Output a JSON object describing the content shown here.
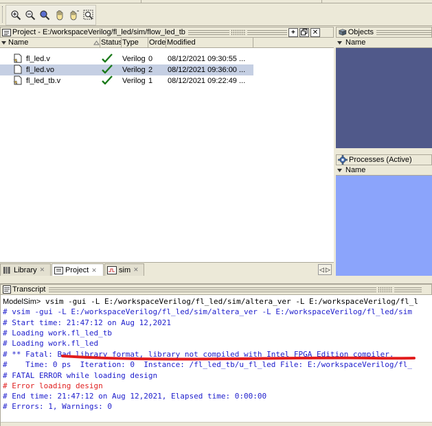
{
  "project_panel": {
    "title": "Project - E:/workspaceVerilog/fl_led/sim/flow_led_tb",
    "columns": [
      "Name",
      "Status",
      "Type",
      "Order",
      "Modified"
    ],
    "files": [
      {
        "name": "fl_led.v",
        "type": "Verilog",
        "order": "0",
        "modified": "08/12/2021 09:30:55 ..."
      },
      {
        "name": "fl_led.vo",
        "type": "Verilog",
        "order": "2",
        "modified": "08/12/2021 09:36:00 ..."
      },
      {
        "name": "fl_led_tb.v",
        "type": "Verilog",
        "order": "1",
        "modified": "08/12/2021 09:22:49 ..."
      }
    ],
    "selected_index": 1
  },
  "objects_panel": {
    "title": "Objects",
    "column": "Name"
  },
  "processes_panel": {
    "title": "Processes (Active)",
    "column": "Name"
  },
  "tabs": [
    {
      "label": "Library"
    },
    {
      "label": "Project"
    },
    {
      "label": "sim"
    }
  ],
  "transcript": {
    "title": "Transcript",
    "prompt": "ModelSim>",
    "command": " vsim -gui -L E:/workspaceVerilog/fl_led/sim/altera_ver -L E:/workspaceVerilog/fl_l",
    "lines": [
      {
        "text": "# vsim -gui -L E:/workspaceVerilog/fl_led/sim/altera_ver -L E:/workspaceVerilog/fl_led/sim",
        "color": "blue"
      },
      {
        "text": "# Start time: 21:47:12 on Aug 12,2021",
        "color": "blue"
      },
      {
        "text": "# Loading work.fl_led_tb",
        "color": "blue"
      },
      {
        "text": "# Loading work.fl_led",
        "color": "blue"
      },
      {
        "text": "# ** Fatal: Bad library format, library not compiled with Intel FPGA Edition compiler.",
        "color": "blue"
      },
      {
        "text": "#    Time: 0 ps  Iteration: 0  Instance: /fl_led_tb/u_fl_led File: E:/workspaceVerilog/fl_",
        "color": "blue"
      },
      {
        "text": "# FATAL ERROR while loading design",
        "color": "blue"
      },
      {
        "text": "# Error loading design",
        "color": "red"
      },
      {
        "text": "# End time: 21:47:12 on Aug 12,2021, Elapsed time: 0:00:00",
        "color": "blue"
      },
      {
        "text": "# Errors: 1, Warnings: 0",
        "color": "blue"
      }
    ]
  },
  "colors": {
    "objects_bg": "#50598a",
    "processes_bg": "#8ba4fb",
    "selection": "#c5cfe3",
    "annotation_underline": "#e21d1d"
  },
  "icons": [
    "zoom-in-icon",
    "zoom-out-icon",
    "zoom-full-icon",
    "zoom-hand-icon",
    "zoom-cursor-icon",
    "zoom-area-icon",
    "verilog-file-icon",
    "checkmark-icon",
    "gear-icon",
    "tab-close-icon"
  ]
}
